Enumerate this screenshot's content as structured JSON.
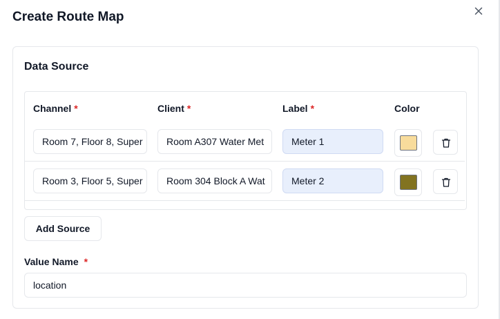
{
  "dialog": {
    "title": "Create Route Map",
    "close_icon": "close-icon"
  },
  "data_source": {
    "title": "Data Source",
    "columns": {
      "channel": "Channel",
      "client": "Client",
      "label": "Label",
      "color": "Color",
      "required_marker": "*"
    },
    "rows": [
      {
        "channel": "Room 7, Floor 8, Super",
        "client": "Room A307 Water Met",
        "label": "Meter 1",
        "color": "#f8dc9c",
        "delete_icon": "trash-icon"
      },
      {
        "channel": "Room 3, Floor 5, Super",
        "client": "Room 304 Block A Wat",
        "label": "Meter 2",
        "color": "#827320",
        "delete_icon": "trash-icon"
      }
    ],
    "add_button": "Add Source"
  },
  "value_name": {
    "label": "Value Name",
    "required_marker": "*",
    "value": "location"
  }
}
